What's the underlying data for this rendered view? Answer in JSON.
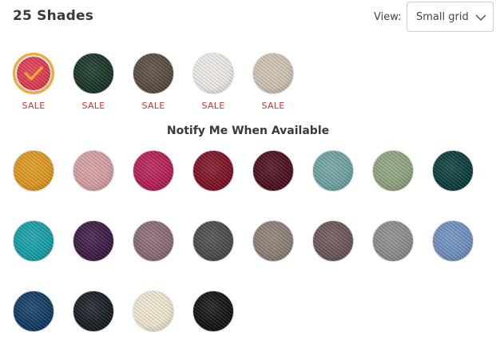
{
  "header": {
    "title": "25 Shades",
    "view_label": "View:",
    "view_selected": "Small grid"
  },
  "sale_label": "SALE",
  "notify_heading": "Notify Me When Available",
  "accent_color": "#f2a93b",
  "sale_color": "#d32f2f",
  "available_swatches": [
    {
      "color": "#e23a4e",
      "selected": true,
      "badge": "SALE"
    },
    {
      "color": "#163424",
      "selected": false,
      "badge": "SALE"
    },
    {
      "color": "#5a4b3e",
      "selected": false,
      "badge": "SALE"
    },
    {
      "color": "#f3efec",
      "selected": false,
      "badge": "SALE"
    },
    {
      "color": "#d3c7b6",
      "selected": false,
      "badge": "SALE"
    }
  ],
  "unavailable_swatches": [
    {
      "color": "#e39a1e"
    },
    {
      "color": "#d9a1a6"
    },
    {
      "color": "#b81d55"
    },
    {
      "color": "#7f0f24"
    },
    {
      "color": "#4c0c1a"
    },
    {
      "color": "#6fa5a5"
    },
    {
      "color": "#92a682"
    },
    {
      "color": "#083c3c"
    },
    {
      "color": "#12a2a8"
    },
    {
      "color": "#3c1844"
    },
    {
      "color": "#8c6b78"
    },
    {
      "color": "#4a4a4a"
    },
    {
      "color": "#8e8076"
    },
    {
      "color": "#6d5656"
    },
    {
      "color": "#8f8f8f"
    },
    {
      "color": "#6f92c2"
    },
    {
      "color": "#0d3b63"
    },
    {
      "color": "#141b22"
    },
    {
      "color": "#f4ecd4"
    },
    {
      "color": "#101010"
    }
  ]
}
